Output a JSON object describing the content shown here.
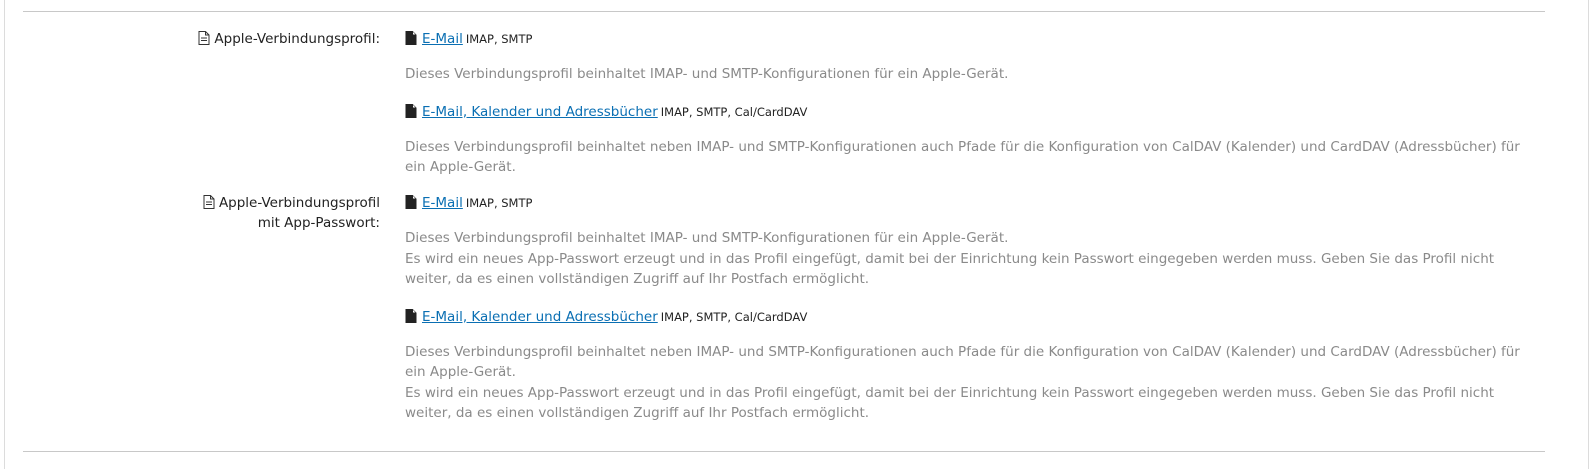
{
  "sections": [
    {
      "label": "Apple-Verbindungsprofil:",
      "label_icon": "document-icon",
      "entries": [
        {
          "link": "E-Mail",
          "tags": "IMAP, SMTP",
          "description": [
            "Dieses Verbindungsprofil beinhaltet IMAP- und SMTP-Konfigurationen für ein Apple-Gerät."
          ]
        },
        {
          "link": "E-Mail, Kalender und Adressbücher",
          "tags": "IMAP, SMTP, Cal/CardDAV",
          "description": [
            "Dieses Verbindungsprofil beinhaltet neben IMAP- und SMTP-Konfigurationen auch Pfade für die Konfiguration von CalDAV (Kalender) und CardDAV (Adressbücher) für ein Apple-Gerät."
          ]
        }
      ]
    },
    {
      "label": "Apple-Verbindungsprofil mit App-Passwort:",
      "label_line1": "Apple-Verbindungsprofil",
      "label_line2": "mit App-Passwort:",
      "label_icon": "document-icon",
      "entries": [
        {
          "link": "E-Mail",
          "tags": "IMAP, SMTP",
          "description": [
            "Dieses Verbindungsprofil beinhaltet IMAP- und SMTP-Konfigurationen für ein Apple-Gerät.",
            "Es wird ein neues App-Passwort erzeugt und in das Profil eingefügt, damit bei der Einrichtung kein Passwort eingegeben werden muss. Geben Sie das Profil nicht weiter, da es einen vollständigen Zugriff auf Ihr Postfach ermöglicht."
          ]
        },
        {
          "link": "E-Mail, Kalender und Adressbücher",
          "tags": "IMAP, SMTP, Cal/CardDAV",
          "description": [
            "Dieses Verbindungsprofil beinhaltet neben IMAP- und SMTP-Konfigurationen auch Pfade für die Konfiguration von CalDAV (Kalender) und CardDAV (Adressbücher) für ein Apple-Gerät.",
            "Es wird ein neues App-Passwort erzeugt und in das Profil eingefügt, damit bei der Einrichtung kein Passwort eingegeben werden muss. Geben Sie das Profil nicht weiter, da es einen vollständigen Zugriff auf Ihr Postfach ermöglicht."
          ]
        }
      ]
    }
  ],
  "icons": {
    "label_icon": "document-outline-icon",
    "link_icon": "file-filled-icon"
  },
  "colors": {
    "link": "#0a6fb3",
    "description": "#8a8a8a",
    "text": "#222222",
    "rule": "#c8c8c8"
  }
}
